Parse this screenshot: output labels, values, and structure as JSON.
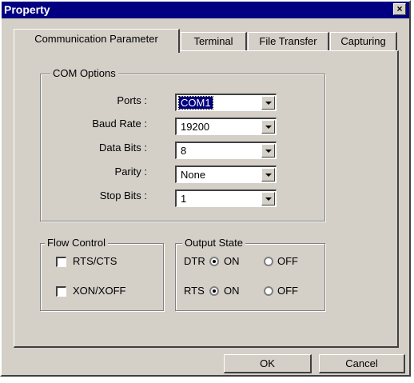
{
  "window": {
    "title": "Property",
    "close_glyph": "×"
  },
  "tabs": [
    {
      "label": "Communication Parameter",
      "active": true
    },
    {
      "label": "Terminal",
      "active": false
    },
    {
      "label": "File Transfer",
      "active": false
    },
    {
      "label": "Capturing",
      "active": false
    }
  ],
  "com_options": {
    "legend": "COM Options",
    "fields": [
      {
        "label": "Ports :",
        "value": "COM1"
      },
      {
        "label": "Baud Rate :",
        "value": "19200"
      },
      {
        "label": "Data Bits :",
        "value": "8"
      },
      {
        "label": "Parity :",
        "value": "None"
      },
      {
        "label": "Stop Bits :",
        "value": "1"
      }
    ]
  },
  "flow_control": {
    "legend": "Flow Control",
    "options": [
      {
        "label": "RTS/CTS",
        "checked": false
      },
      {
        "label": "XON/XOFF",
        "checked": false
      }
    ]
  },
  "output_state": {
    "legend": "Output State",
    "rows": [
      {
        "signal": "DTR",
        "on_label": "ON",
        "off_label": "OFF",
        "selected": "ON"
      },
      {
        "signal": "RTS",
        "on_label": "ON",
        "off_label": "OFF",
        "selected": "ON"
      }
    ]
  },
  "buttons": {
    "ok": "OK",
    "cancel": "Cancel"
  }
}
